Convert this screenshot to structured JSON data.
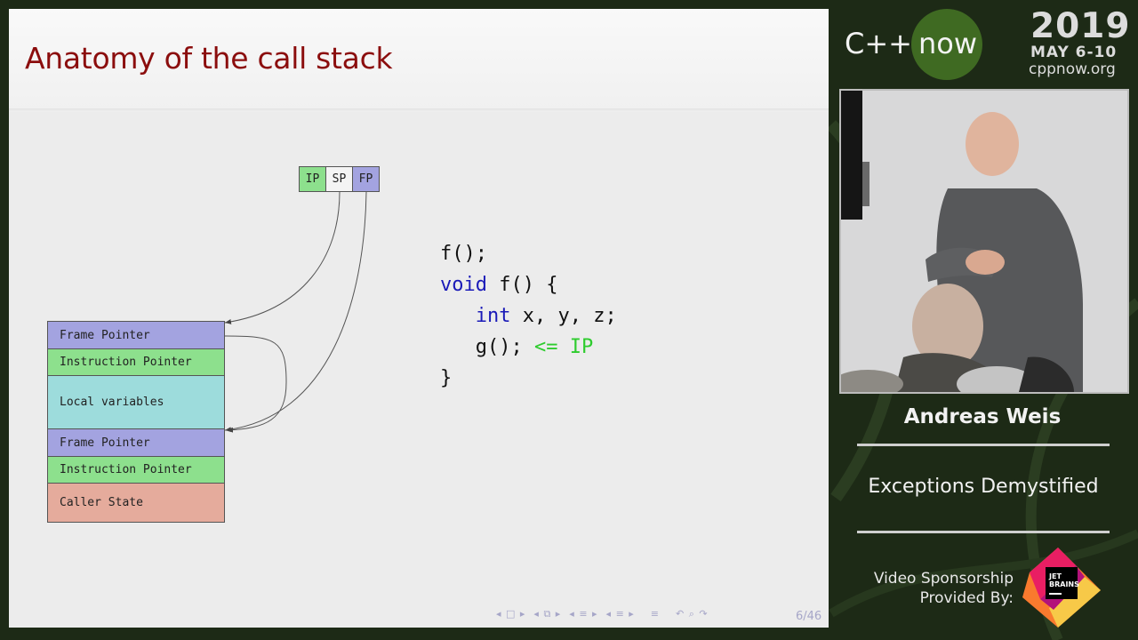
{
  "slide": {
    "title": "Anatomy of the call stack",
    "registers": [
      "IP",
      "SP",
      "FP"
    ],
    "stack_cells": [
      "Frame Pointer",
      "Instruction Pointer",
      "Local variables",
      "Frame Pointer",
      "Instruction Pointer",
      "Caller State"
    ],
    "code": {
      "line1": "f();",
      "line2_kw": "void",
      "line2_rest": " f() {",
      "line3_kw": "int",
      "line3_rest": " x, y, z;",
      "line4_code": "g(); ",
      "line4_marker": "<= IP",
      "line5": "}"
    },
    "page_number": "6/46"
  },
  "event": {
    "logo_left": "C++",
    "logo_right": "now",
    "year": "2019",
    "dates": "MAY 6-10",
    "site": "cppnow.org"
  },
  "speaker": "Andreas Weis",
  "talk_title": "Exceptions Demystified",
  "sponsor": {
    "line1": "Video Sponsorship",
    "line2": "Provided By:",
    "logo_text_top": "JET",
    "logo_text_bottom": "BRAINS"
  },
  "colors": {
    "title": "#8b0d0d",
    "keyword": "#1a1ab8",
    "highlight": "#2ecc2e",
    "ip_cell": "#8de08d",
    "fp_cell": "#a3a3e0",
    "local_cell": "#9ddcdc",
    "caller_cell": "#e5ab9c"
  }
}
